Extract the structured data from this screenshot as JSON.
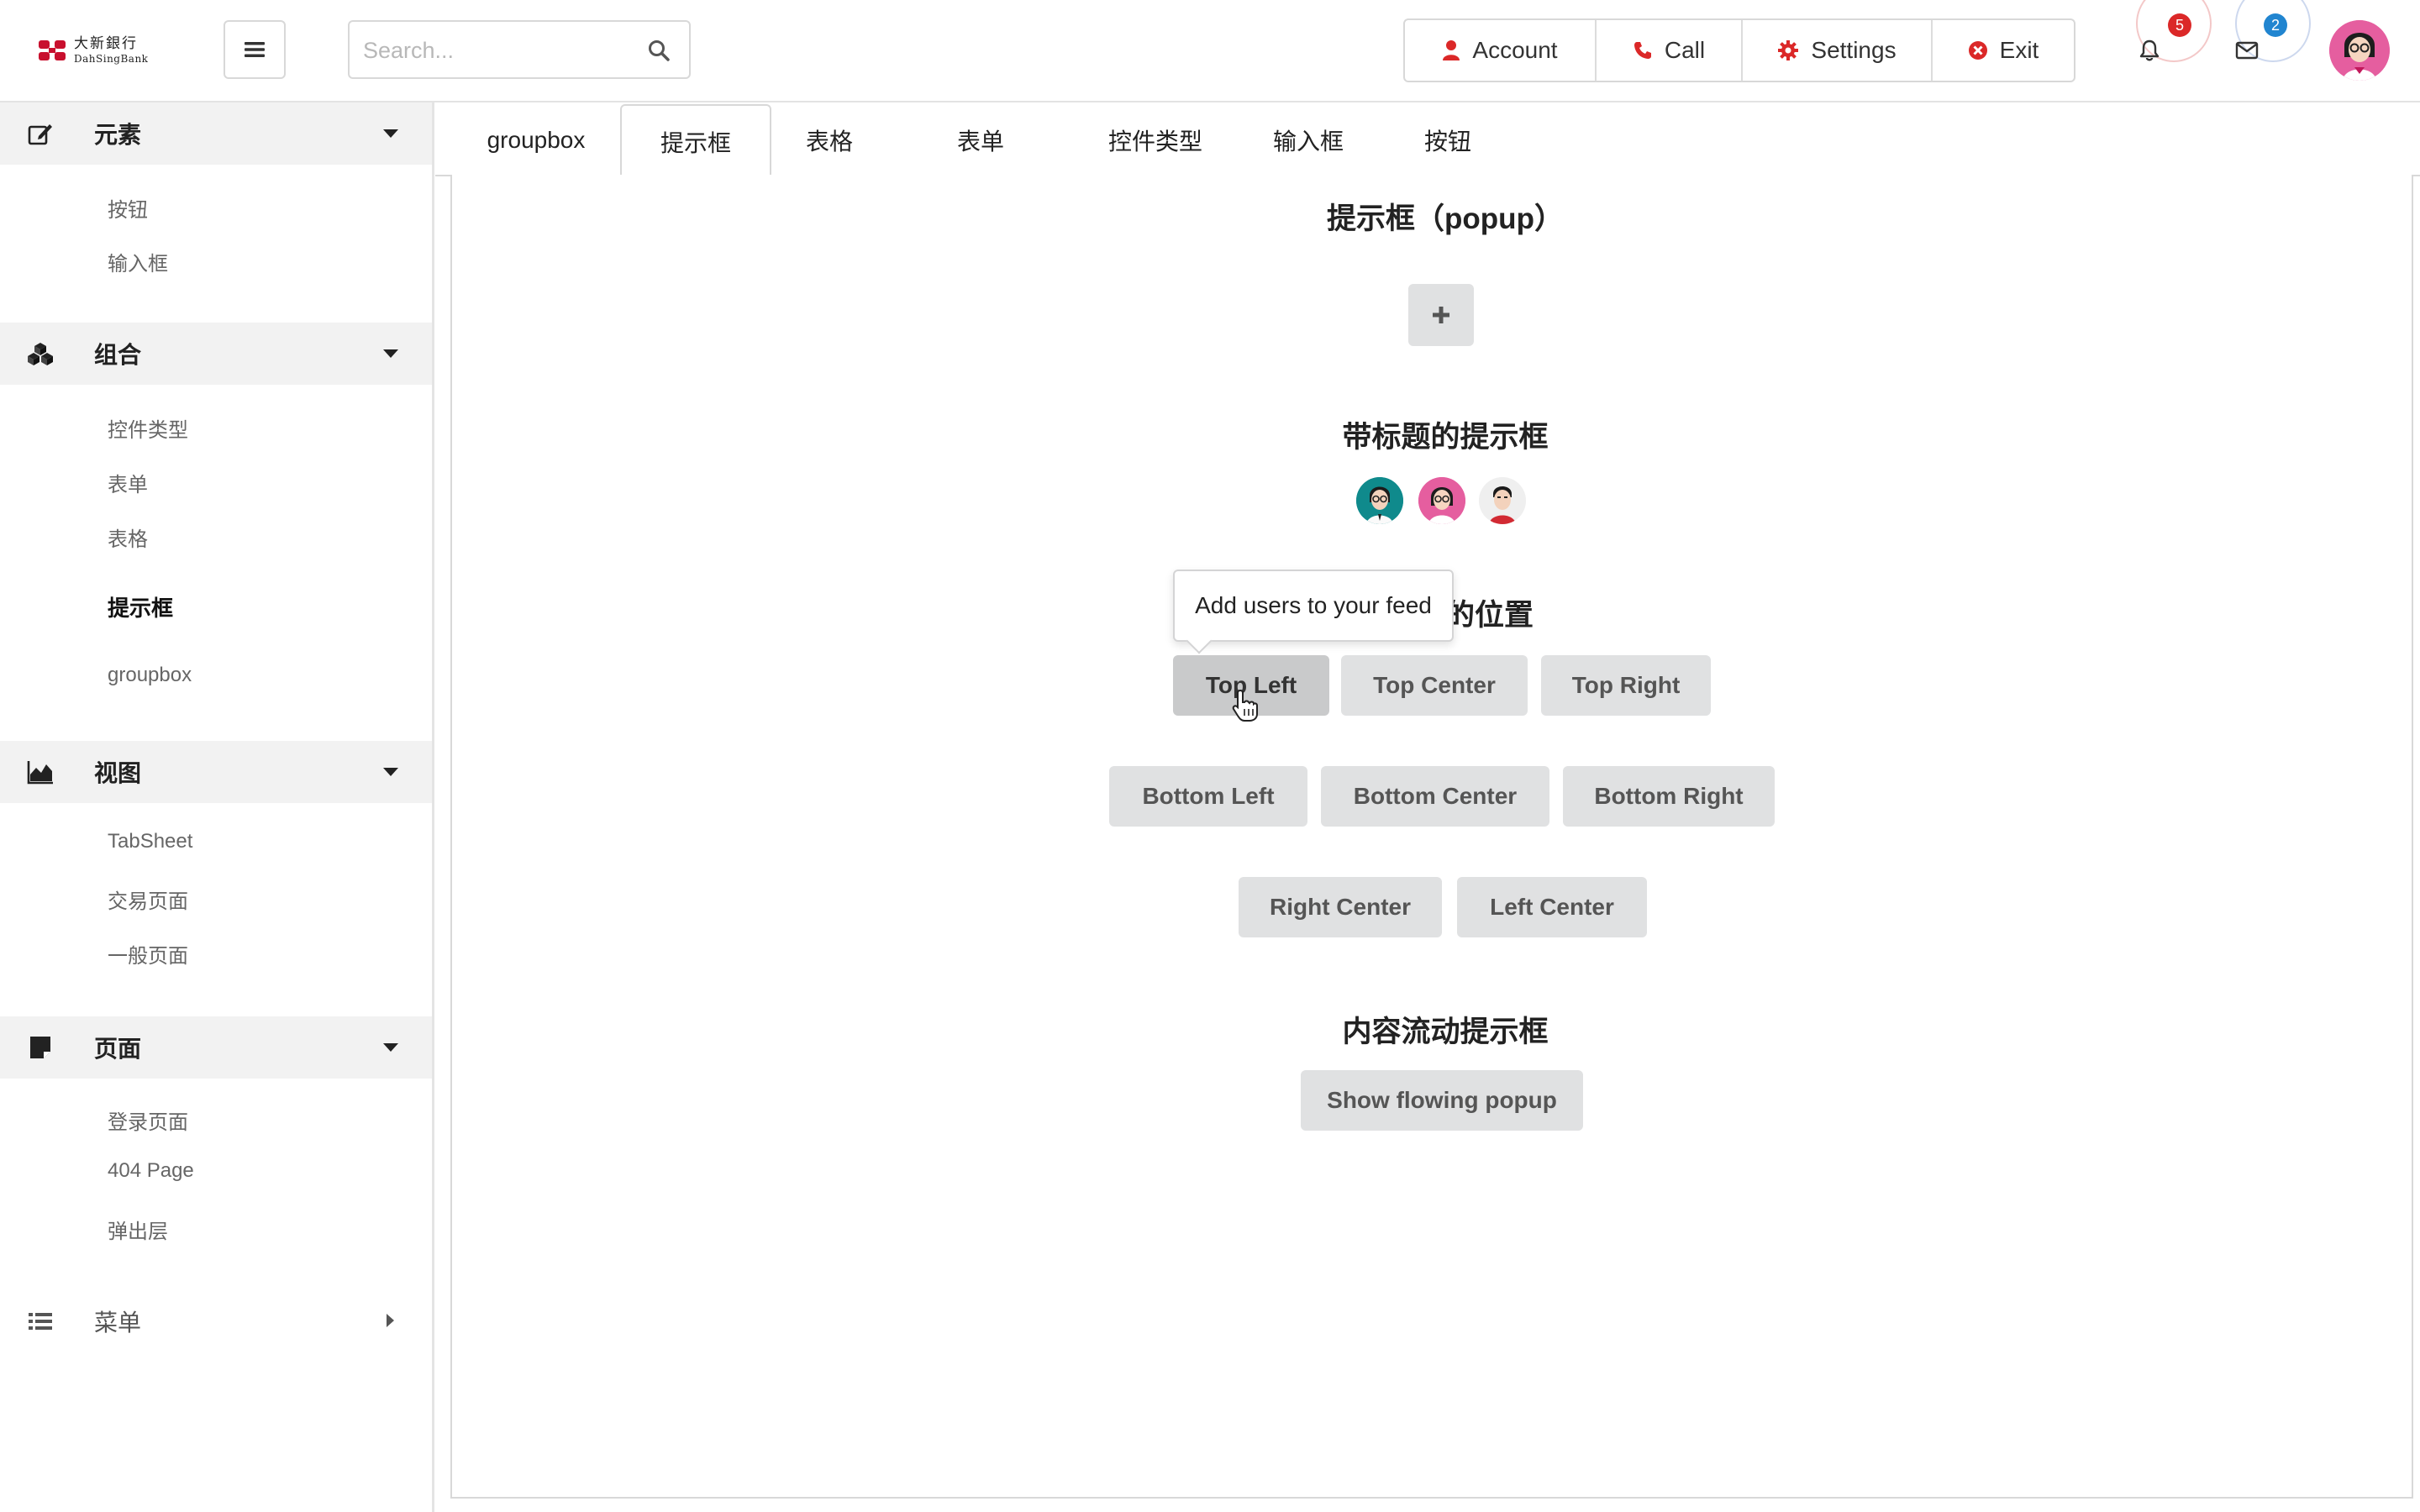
{
  "header": {
    "logo": {
      "cn": "大新銀行",
      "en": "DahSingBank"
    },
    "search": {
      "placeholder": "Search..."
    },
    "menu": [
      {
        "label": "Account",
        "icon": "user-icon"
      },
      {
        "label": "Call",
        "icon": "phone-icon"
      },
      {
        "label": "Settings",
        "icon": "gear-icon"
      },
      {
        "label": "Exit",
        "icon": "close-circle-icon"
      }
    ],
    "notifications": {
      "count": "5",
      "icon": "bell-icon",
      "color": "#db2828"
    },
    "messages": {
      "count": "2",
      "icon": "envelope-icon",
      "color": "#2185d0"
    }
  },
  "sidebar": {
    "sections": [
      {
        "label": "元素",
        "icon": "edit-icon",
        "items": [
          "按钮",
          "输入框"
        ]
      },
      {
        "label": "组合",
        "icon": "cubes-icon",
        "items": [
          "控件类型",
          "表单",
          "表格",
          "提示框",
          "groupbox"
        ]
      },
      {
        "label": "视图",
        "icon": "area-chart-icon",
        "items": [
          "TabSheet",
          "交易页面",
          "一般页面"
        ]
      },
      {
        "label": "页面",
        "icon": "sticky-note-icon",
        "items": [
          "登录页面",
          "404 Page",
          "弹出层"
        ]
      },
      {
        "label": "菜单",
        "icon": "list-icon",
        "items": []
      }
    ],
    "active_item": "提示框"
  },
  "tabs": [
    {
      "label": "groupbox",
      "active": false
    },
    {
      "label": "提示框",
      "active": true
    },
    {
      "label": "表格",
      "active": false
    },
    {
      "label": "表单",
      "active": false
    },
    {
      "label": "控件类型",
      "active": false
    },
    {
      "label": "输入框",
      "active": false
    },
    {
      "label": "按钮",
      "active": false
    }
  ],
  "main": {
    "popup_title": "提示框（popup）",
    "plus_label": "+",
    "titled_title": "带标题的提示框",
    "position_title": "提示框的位置",
    "position_title_visible": "的位置",
    "position_buttons": {
      "top_left": "Top Left",
      "top_center": "Top Center",
      "top_right": "Top Right",
      "bottom_left": "Bottom Left",
      "bottom_center": "Bottom Center",
      "bottom_right": "Bottom Right",
      "right_center": "Right Center",
      "left_center": "Left Center"
    },
    "tooltip_text": "Add users to your feed",
    "flowing_title": "内容流动提示框",
    "flowing_button": "Show flowing popup"
  },
  "colors": {
    "brand_red": "#c8102e",
    "icon_red": "#db2828",
    "button_gray": "#e0e1e2"
  }
}
